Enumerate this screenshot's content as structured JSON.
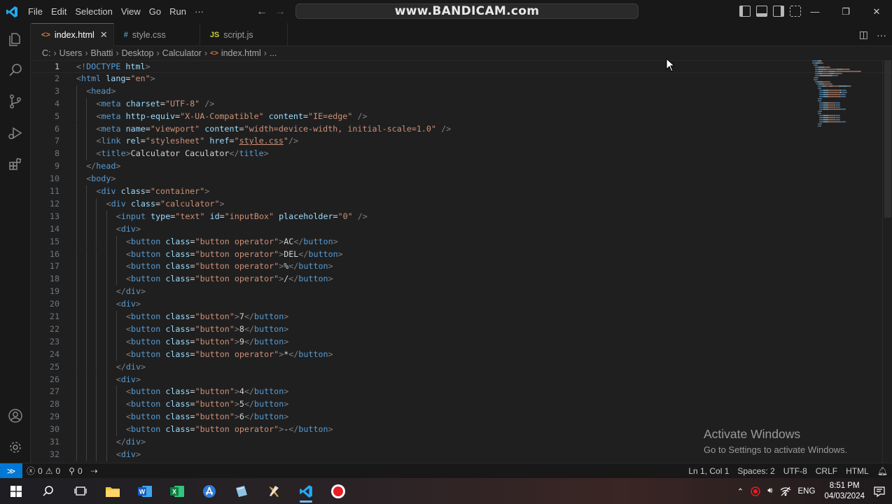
{
  "titlebar": {
    "menu": [
      "File",
      "Edit",
      "Selection",
      "View",
      "Go",
      "Run",
      "···"
    ],
    "command_center_text": "www.BANDICAM.com"
  },
  "tabs": [
    {
      "icon": "<>",
      "label": "index.html",
      "active": true,
      "close": "✕"
    },
    {
      "icon": "#",
      "label": "style.css",
      "active": false
    },
    {
      "icon": "JS",
      "label": "script.js",
      "active": false
    }
  ],
  "breadcrumb": [
    "C:",
    "Users",
    "Bhatti",
    "Desktop",
    "Calculator",
    "index.html",
    "..."
  ],
  "editor": {
    "current_line": 1,
    "lines": [
      {
        "n": "1",
        "indent": 0,
        "tokens": [
          [
            "br",
            "<!"
          ],
          [
            "tag",
            "DOCTYPE"
          ],
          [
            "txt",
            " "
          ],
          [
            "attr",
            "html"
          ],
          [
            "br",
            ">"
          ]
        ]
      },
      {
        "n": "2",
        "indent": 0,
        "tokens": [
          [
            "br",
            "<"
          ],
          [
            "tag",
            "html"
          ],
          [
            "txt",
            " "
          ],
          [
            "attr",
            "lang"
          ],
          [
            "txt",
            "="
          ],
          [
            "str",
            "\"en\""
          ],
          [
            "br",
            ">"
          ]
        ]
      },
      {
        "n": "3",
        "indent": 1,
        "tokens": [
          [
            "br",
            "<"
          ],
          [
            "tag",
            "head"
          ],
          [
            "br",
            ">"
          ]
        ]
      },
      {
        "n": "4",
        "indent": 2,
        "tokens": [
          [
            "br",
            "<"
          ],
          [
            "tag",
            "meta"
          ],
          [
            "txt",
            " "
          ],
          [
            "attr",
            "charset"
          ],
          [
            "txt",
            "="
          ],
          [
            "str",
            "\"UTF-8\""
          ],
          [
            "txt",
            " "
          ],
          [
            "br",
            "/>"
          ]
        ]
      },
      {
        "n": "5",
        "indent": 2,
        "tokens": [
          [
            "br",
            "<"
          ],
          [
            "tag",
            "meta"
          ],
          [
            "txt",
            " "
          ],
          [
            "attr",
            "http-equiv"
          ],
          [
            "txt",
            "="
          ],
          [
            "str",
            "\"X-UA-Compatible\""
          ],
          [
            "txt",
            " "
          ],
          [
            "attr",
            "content"
          ],
          [
            "txt",
            "="
          ],
          [
            "str",
            "\"IE=edge\""
          ],
          [
            "txt",
            " "
          ],
          [
            "br",
            "/>"
          ]
        ]
      },
      {
        "n": "6",
        "indent": 2,
        "tokens": [
          [
            "br",
            "<"
          ],
          [
            "tag",
            "meta"
          ],
          [
            "txt",
            " "
          ],
          [
            "attr",
            "name"
          ],
          [
            "txt",
            "="
          ],
          [
            "str",
            "\"viewport\""
          ],
          [
            "txt",
            " "
          ],
          [
            "attr",
            "content"
          ],
          [
            "txt",
            "="
          ],
          [
            "str",
            "\"width=device-width, initial-scale=1.0\""
          ],
          [
            "txt",
            " "
          ],
          [
            "br",
            "/>"
          ]
        ]
      },
      {
        "n": "7",
        "indent": 2,
        "tokens": [
          [
            "br",
            "<"
          ],
          [
            "tag",
            "link"
          ],
          [
            "txt",
            " "
          ],
          [
            "attr",
            "rel"
          ],
          [
            "txt",
            "="
          ],
          [
            "str",
            "\"stylesheet\""
          ],
          [
            "txt",
            " "
          ],
          [
            "attr",
            "href"
          ],
          [
            "txt",
            "="
          ],
          [
            "str",
            "\""
          ],
          [
            "link",
            "style.css"
          ],
          [
            "str",
            "\""
          ],
          [
            "br",
            "/>"
          ]
        ]
      },
      {
        "n": "8",
        "indent": 2,
        "tokens": [
          [
            "br",
            "<"
          ],
          [
            "tag",
            "title"
          ],
          [
            "br",
            ">"
          ],
          [
            "txt",
            "Calculator Caculator"
          ],
          [
            "br",
            "</"
          ],
          [
            "tag",
            "title"
          ],
          [
            "br",
            ">"
          ]
        ]
      },
      {
        "n": "9",
        "indent": 1,
        "tokens": [
          [
            "br",
            "</"
          ],
          [
            "tag",
            "head"
          ],
          [
            "br",
            ">"
          ]
        ]
      },
      {
        "n": "10",
        "indent": 1,
        "tokens": [
          [
            "br",
            "<"
          ],
          [
            "tag",
            "body"
          ],
          [
            "br",
            ">"
          ]
        ]
      },
      {
        "n": "11",
        "indent": 2,
        "tokens": [
          [
            "br",
            "<"
          ],
          [
            "tag",
            "div"
          ],
          [
            "txt",
            " "
          ],
          [
            "attr",
            "class"
          ],
          [
            "txt",
            "="
          ],
          [
            "str",
            "\"container\""
          ],
          [
            "br",
            ">"
          ]
        ]
      },
      {
        "n": "12",
        "indent": 3,
        "tokens": [
          [
            "br",
            "<"
          ],
          [
            "tag",
            "div"
          ],
          [
            "txt",
            " "
          ],
          [
            "attr",
            "class"
          ],
          [
            "txt",
            "="
          ],
          [
            "str",
            "\"calculator\""
          ],
          [
            "br",
            ">"
          ]
        ]
      },
      {
        "n": "13",
        "indent": 4,
        "tokens": [
          [
            "br",
            "<"
          ],
          [
            "tag",
            "input"
          ],
          [
            "txt",
            " "
          ],
          [
            "attr",
            "type"
          ],
          [
            "txt",
            "="
          ],
          [
            "str",
            "\"text\""
          ],
          [
            "txt",
            " "
          ],
          [
            "attr",
            "id"
          ],
          [
            "txt",
            "="
          ],
          [
            "str",
            "\"inputBox\""
          ],
          [
            "txt",
            " "
          ],
          [
            "attr",
            "placeholder"
          ],
          [
            "txt",
            "="
          ],
          [
            "str",
            "\"0\""
          ],
          [
            "txt",
            " "
          ],
          [
            "br",
            "/>"
          ]
        ]
      },
      {
        "n": "14",
        "indent": 4,
        "tokens": [
          [
            "br",
            "<"
          ],
          [
            "tag",
            "div"
          ],
          [
            "br",
            ">"
          ]
        ]
      },
      {
        "n": "15",
        "indent": 5,
        "tokens": [
          [
            "br",
            "<"
          ],
          [
            "tag",
            "button"
          ],
          [
            "txt",
            " "
          ],
          [
            "attr",
            "class"
          ],
          [
            "txt",
            "="
          ],
          [
            "str",
            "\"button operator\""
          ],
          [
            "br",
            ">"
          ],
          [
            "txt",
            "AC"
          ],
          [
            "br",
            "</"
          ],
          [
            "tag",
            "button"
          ],
          [
            "br",
            ">"
          ]
        ]
      },
      {
        "n": "16",
        "indent": 5,
        "tokens": [
          [
            "br",
            "<"
          ],
          [
            "tag",
            "button"
          ],
          [
            "txt",
            " "
          ],
          [
            "attr",
            "class"
          ],
          [
            "txt",
            "="
          ],
          [
            "str",
            "\"button operator\""
          ],
          [
            "br",
            ">"
          ],
          [
            "txt",
            "DEL"
          ],
          [
            "br",
            "</"
          ],
          [
            "tag",
            "button"
          ],
          [
            "br",
            ">"
          ]
        ]
      },
      {
        "n": "17",
        "indent": 5,
        "tokens": [
          [
            "br",
            "<"
          ],
          [
            "tag",
            "button"
          ],
          [
            "txt",
            " "
          ],
          [
            "attr",
            "class"
          ],
          [
            "txt",
            "="
          ],
          [
            "str",
            "\"button operator\""
          ],
          [
            "br",
            ">"
          ],
          [
            "txt",
            "%"
          ],
          [
            "br",
            "</"
          ],
          [
            "tag",
            "button"
          ],
          [
            "br",
            ">"
          ]
        ]
      },
      {
        "n": "18",
        "indent": 5,
        "tokens": [
          [
            "br",
            "<"
          ],
          [
            "tag",
            "button"
          ],
          [
            "txt",
            " "
          ],
          [
            "attr",
            "class"
          ],
          [
            "txt",
            "="
          ],
          [
            "str",
            "\"button operator\""
          ],
          [
            "br",
            ">"
          ],
          [
            "txt",
            "/"
          ],
          [
            "br",
            "</"
          ],
          [
            "tag",
            "button"
          ],
          [
            "br",
            ">"
          ]
        ]
      },
      {
        "n": "19",
        "indent": 4,
        "tokens": [
          [
            "br",
            "</"
          ],
          [
            "tag",
            "div"
          ],
          [
            "br",
            ">"
          ]
        ]
      },
      {
        "n": "20",
        "indent": 4,
        "tokens": [
          [
            "br",
            "<"
          ],
          [
            "tag",
            "div"
          ],
          [
            "br",
            ">"
          ]
        ]
      },
      {
        "n": "21",
        "indent": 5,
        "tokens": [
          [
            "br",
            "<"
          ],
          [
            "tag",
            "button"
          ],
          [
            "txt",
            " "
          ],
          [
            "attr",
            "class"
          ],
          [
            "txt",
            "="
          ],
          [
            "str",
            "\"button\""
          ],
          [
            "br",
            ">"
          ],
          [
            "txt",
            "7"
          ],
          [
            "br",
            "</"
          ],
          [
            "tag",
            "button"
          ],
          [
            "br",
            ">"
          ]
        ]
      },
      {
        "n": "22",
        "indent": 5,
        "tokens": [
          [
            "br",
            "<"
          ],
          [
            "tag",
            "button"
          ],
          [
            "txt",
            " "
          ],
          [
            "attr",
            "class"
          ],
          [
            "txt",
            "="
          ],
          [
            "str",
            "\"button\""
          ],
          [
            "br",
            ">"
          ],
          [
            "txt",
            "8"
          ],
          [
            "br",
            "</"
          ],
          [
            "tag",
            "button"
          ],
          [
            "br",
            ">"
          ]
        ]
      },
      {
        "n": "23",
        "indent": 5,
        "tokens": [
          [
            "br",
            "<"
          ],
          [
            "tag",
            "button"
          ],
          [
            "txt",
            " "
          ],
          [
            "attr",
            "class"
          ],
          [
            "txt",
            "="
          ],
          [
            "str",
            "\"button\""
          ],
          [
            "br",
            ">"
          ],
          [
            "txt",
            "9"
          ],
          [
            "br",
            "</"
          ],
          [
            "tag",
            "button"
          ],
          [
            "br",
            ">"
          ]
        ]
      },
      {
        "n": "24",
        "indent": 5,
        "tokens": [
          [
            "br",
            "<"
          ],
          [
            "tag",
            "button"
          ],
          [
            "txt",
            " "
          ],
          [
            "attr",
            "class"
          ],
          [
            "txt",
            "="
          ],
          [
            "str",
            "\"button operator\""
          ],
          [
            "br",
            ">"
          ],
          [
            "txt",
            "*"
          ],
          [
            "br",
            "</"
          ],
          [
            "tag",
            "button"
          ],
          [
            "br",
            ">"
          ]
        ]
      },
      {
        "n": "25",
        "indent": 4,
        "tokens": [
          [
            "br",
            "</"
          ],
          [
            "tag",
            "div"
          ],
          [
            "br",
            ">"
          ]
        ]
      },
      {
        "n": "26",
        "indent": 4,
        "tokens": [
          [
            "br",
            "<"
          ],
          [
            "tag",
            "div"
          ],
          [
            "br",
            ">"
          ]
        ]
      },
      {
        "n": "27",
        "indent": 5,
        "tokens": [
          [
            "br",
            "<"
          ],
          [
            "tag",
            "button"
          ],
          [
            "txt",
            " "
          ],
          [
            "attr",
            "class"
          ],
          [
            "txt",
            "="
          ],
          [
            "str",
            "\"button\""
          ],
          [
            "br",
            ">"
          ],
          [
            "txt",
            "4"
          ],
          [
            "br",
            "</"
          ],
          [
            "tag",
            "button"
          ],
          [
            "br",
            ">"
          ]
        ]
      },
      {
        "n": "28",
        "indent": 5,
        "tokens": [
          [
            "br",
            "<"
          ],
          [
            "tag",
            "button"
          ],
          [
            "txt",
            " "
          ],
          [
            "attr",
            "class"
          ],
          [
            "txt",
            "="
          ],
          [
            "str",
            "\"button\""
          ],
          [
            "br",
            ">"
          ],
          [
            "txt",
            "5"
          ],
          [
            "br",
            "</"
          ],
          [
            "tag",
            "button"
          ],
          [
            "br",
            ">"
          ]
        ]
      },
      {
        "n": "29",
        "indent": 5,
        "tokens": [
          [
            "br",
            "<"
          ],
          [
            "tag",
            "button"
          ],
          [
            "txt",
            " "
          ],
          [
            "attr",
            "class"
          ],
          [
            "txt",
            "="
          ],
          [
            "str",
            "\"button\""
          ],
          [
            "br",
            ">"
          ],
          [
            "txt",
            "6"
          ],
          [
            "br",
            "</"
          ],
          [
            "tag",
            "button"
          ],
          [
            "br",
            ">"
          ]
        ]
      },
      {
        "n": "30",
        "indent": 5,
        "tokens": [
          [
            "br",
            "<"
          ],
          [
            "tag",
            "button"
          ],
          [
            "txt",
            " "
          ],
          [
            "attr",
            "class"
          ],
          [
            "txt",
            "="
          ],
          [
            "str",
            "\"button operator\""
          ],
          [
            "br",
            ">"
          ],
          [
            "txt",
            "-"
          ],
          [
            "br",
            "</"
          ],
          [
            "tag",
            "button"
          ],
          [
            "br",
            ">"
          ]
        ]
      },
      {
        "n": "31",
        "indent": 4,
        "tokens": [
          [
            "br",
            "</"
          ],
          [
            "tag",
            "div"
          ],
          [
            "br",
            ">"
          ]
        ]
      },
      {
        "n": "32",
        "indent": 4,
        "tokens": [
          [
            "br",
            "<"
          ],
          [
            "tag",
            "div"
          ],
          [
            "br",
            ">"
          ]
        ]
      }
    ]
  },
  "watermark_notice": {
    "title": "Activate Windows",
    "subtitle": "Go to Settings to activate Windows."
  },
  "statusbar": {
    "errors": "0",
    "warnings": "0",
    "ports": "0",
    "cursor": "Ln 1, Col 1",
    "spaces": "Spaces: 2",
    "encoding": "UTF-8",
    "eol": "CRLF",
    "language": "HTML"
  },
  "taskbar": {
    "language": "ENG",
    "time": "8:51 PM",
    "date": "04/03/2024"
  },
  "colors": {
    "accent": "#0078d4",
    "tag": "#569cd6",
    "attribute": "#9cdcfe",
    "string": "#ce9178"
  }
}
